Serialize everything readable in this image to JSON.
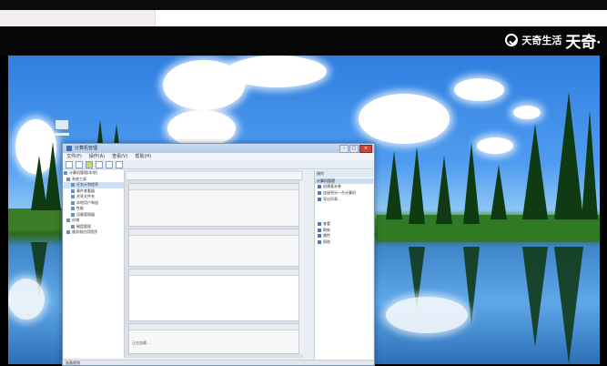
{
  "watermark": {
    "brand": "天奇生活",
    "big": "天奇·",
    "icon": "check-circle-icon"
  },
  "window": {
    "title": "计算机管理",
    "menu": [
      "文件(F)",
      "操作(A)",
      "查看(V)",
      "帮助(H)"
    ],
    "tree": [
      "计算机管理(本地)",
      "系统工具",
      "任务计划程序",
      "事件查看器",
      "共享文件夹",
      "本地用户和组",
      "性能",
      "设备管理器",
      "存储",
      "磁盘管理",
      "服务和应用程序"
    ],
    "actions_header": "操作",
    "actions_sub": "计算机管理",
    "actions": [
      "创建基本卷",
      "连接到另一台计算机",
      "导出列表...",
      "查看",
      "刷新",
      "属性",
      "帮助"
    ],
    "center_status": "正在加载...",
    "statusbar": "准备就绪"
  },
  "colors": {
    "sky": "#3f8ee6",
    "window_frame": "#7d93b2",
    "selection": "#cfe0f6"
  }
}
